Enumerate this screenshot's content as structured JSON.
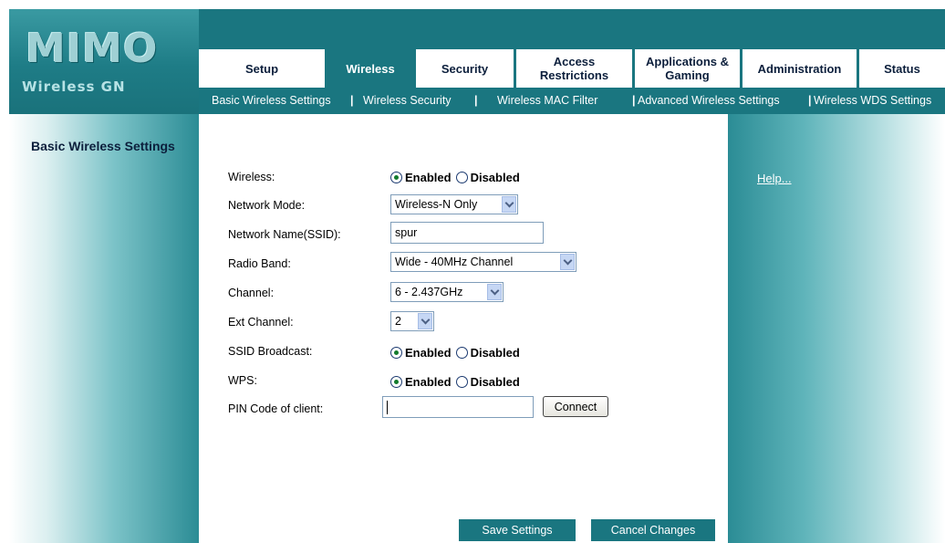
{
  "logo": {
    "title": "MIMO",
    "subtitle": "Wireless GN"
  },
  "tabs": [
    {
      "label": "Setup"
    },
    {
      "label": "Wireless"
    },
    {
      "label": "Security"
    },
    {
      "label": "Access Restrictions"
    },
    {
      "label": "Applications & Gaming"
    },
    {
      "label": "Administration"
    },
    {
      "label": "Status"
    }
  ],
  "active_tab": "Wireless",
  "subnav": [
    {
      "label": "Basic Wireless Settings"
    },
    {
      "label": "Wireless Security"
    },
    {
      "label": "Wireless MAC Filter"
    },
    {
      "label": "Advanced Wireless Settings"
    },
    {
      "label": "Wireless WDS Settings"
    }
  ],
  "page_title": "Basic Wireless Settings",
  "help_link": "Help...",
  "form": {
    "wireless": {
      "label": "Wireless:",
      "options": [
        "Enabled",
        "Disabled"
      ],
      "selected": "Enabled"
    },
    "network_mode": {
      "label": "Network Mode:",
      "value": "Wireless-N Only"
    },
    "ssid": {
      "label": "Network Name(SSID):",
      "value": "spur"
    },
    "radio_band": {
      "label": "Radio Band:",
      "value": "Wide - 40MHz Channel"
    },
    "channel": {
      "label": "Channel:",
      "value": "6 - 2.437GHz"
    },
    "ext_channel": {
      "label": "Ext Channel:",
      "value": "2"
    },
    "ssid_broadcast": {
      "label": "SSID Broadcast:",
      "options": [
        "Enabled",
        "Disabled"
      ],
      "selected": "Enabled"
    },
    "wps": {
      "label": "WPS:",
      "options": [
        "Enabled",
        "Disabled"
      ],
      "selected": "Enabled"
    },
    "pin_code": {
      "label": "PIN Code of client:",
      "value": ""
    },
    "connect_label": "Connect"
  },
  "buttons": {
    "save": "Save Settings",
    "cancel": "Cancel Changes"
  },
  "colors": {
    "teal": "#1a7680",
    "navy_text": "#0c1f3c",
    "radio_selected": "#137b2c"
  }
}
